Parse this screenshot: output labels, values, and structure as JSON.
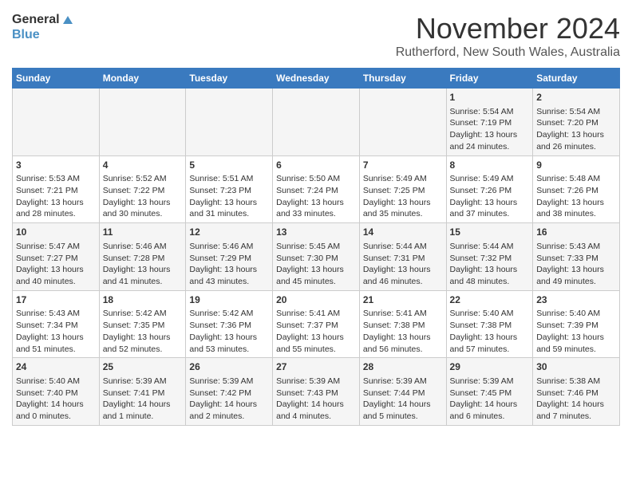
{
  "logo": {
    "line1": "General",
    "line2": "Blue"
  },
  "title": "November 2024",
  "location": "Rutherford, New South Wales, Australia",
  "weekdays": [
    "Sunday",
    "Monday",
    "Tuesday",
    "Wednesday",
    "Thursday",
    "Friday",
    "Saturday"
  ],
  "weeks": [
    [
      {
        "day": "",
        "content": ""
      },
      {
        "day": "",
        "content": ""
      },
      {
        "day": "",
        "content": ""
      },
      {
        "day": "",
        "content": ""
      },
      {
        "day": "",
        "content": ""
      },
      {
        "day": "1",
        "content": "Sunrise: 5:54 AM\nSunset: 7:19 PM\nDaylight: 13 hours\nand 24 minutes."
      },
      {
        "day": "2",
        "content": "Sunrise: 5:54 AM\nSunset: 7:20 PM\nDaylight: 13 hours\nand 26 minutes."
      }
    ],
    [
      {
        "day": "3",
        "content": "Sunrise: 5:53 AM\nSunset: 7:21 PM\nDaylight: 13 hours\nand 28 minutes."
      },
      {
        "day": "4",
        "content": "Sunrise: 5:52 AM\nSunset: 7:22 PM\nDaylight: 13 hours\nand 30 minutes."
      },
      {
        "day": "5",
        "content": "Sunrise: 5:51 AM\nSunset: 7:23 PM\nDaylight: 13 hours\nand 31 minutes."
      },
      {
        "day": "6",
        "content": "Sunrise: 5:50 AM\nSunset: 7:24 PM\nDaylight: 13 hours\nand 33 minutes."
      },
      {
        "day": "7",
        "content": "Sunrise: 5:49 AM\nSunset: 7:25 PM\nDaylight: 13 hours\nand 35 minutes."
      },
      {
        "day": "8",
        "content": "Sunrise: 5:49 AM\nSunset: 7:26 PM\nDaylight: 13 hours\nand 37 minutes."
      },
      {
        "day": "9",
        "content": "Sunrise: 5:48 AM\nSunset: 7:26 PM\nDaylight: 13 hours\nand 38 minutes."
      }
    ],
    [
      {
        "day": "10",
        "content": "Sunrise: 5:47 AM\nSunset: 7:27 PM\nDaylight: 13 hours\nand 40 minutes."
      },
      {
        "day": "11",
        "content": "Sunrise: 5:46 AM\nSunset: 7:28 PM\nDaylight: 13 hours\nand 41 minutes."
      },
      {
        "day": "12",
        "content": "Sunrise: 5:46 AM\nSunset: 7:29 PM\nDaylight: 13 hours\nand 43 minutes."
      },
      {
        "day": "13",
        "content": "Sunrise: 5:45 AM\nSunset: 7:30 PM\nDaylight: 13 hours\nand 45 minutes."
      },
      {
        "day": "14",
        "content": "Sunrise: 5:44 AM\nSunset: 7:31 PM\nDaylight: 13 hours\nand 46 minutes."
      },
      {
        "day": "15",
        "content": "Sunrise: 5:44 AM\nSunset: 7:32 PM\nDaylight: 13 hours\nand 48 minutes."
      },
      {
        "day": "16",
        "content": "Sunrise: 5:43 AM\nSunset: 7:33 PM\nDaylight: 13 hours\nand 49 minutes."
      }
    ],
    [
      {
        "day": "17",
        "content": "Sunrise: 5:43 AM\nSunset: 7:34 PM\nDaylight: 13 hours\nand 51 minutes."
      },
      {
        "day": "18",
        "content": "Sunrise: 5:42 AM\nSunset: 7:35 PM\nDaylight: 13 hours\nand 52 minutes."
      },
      {
        "day": "19",
        "content": "Sunrise: 5:42 AM\nSunset: 7:36 PM\nDaylight: 13 hours\nand 53 minutes."
      },
      {
        "day": "20",
        "content": "Sunrise: 5:41 AM\nSunset: 7:37 PM\nDaylight: 13 hours\nand 55 minutes."
      },
      {
        "day": "21",
        "content": "Sunrise: 5:41 AM\nSunset: 7:38 PM\nDaylight: 13 hours\nand 56 minutes."
      },
      {
        "day": "22",
        "content": "Sunrise: 5:40 AM\nSunset: 7:38 PM\nDaylight: 13 hours\nand 57 minutes."
      },
      {
        "day": "23",
        "content": "Sunrise: 5:40 AM\nSunset: 7:39 PM\nDaylight: 13 hours\nand 59 minutes."
      }
    ],
    [
      {
        "day": "24",
        "content": "Sunrise: 5:40 AM\nSunset: 7:40 PM\nDaylight: 14 hours\nand 0 minutes."
      },
      {
        "day": "25",
        "content": "Sunrise: 5:39 AM\nSunset: 7:41 PM\nDaylight: 14 hours\nand 1 minute."
      },
      {
        "day": "26",
        "content": "Sunrise: 5:39 AM\nSunset: 7:42 PM\nDaylight: 14 hours\nand 2 minutes."
      },
      {
        "day": "27",
        "content": "Sunrise: 5:39 AM\nSunset: 7:43 PM\nDaylight: 14 hours\nand 4 minutes."
      },
      {
        "day": "28",
        "content": "Sunrise: 5:39 AM\nSunset: 7:44 PM\nDaylight: 14 hours\nand 5 minutes."
      },
      {
        "day": "29",
        "content": "Sunrise: 5:39 AM\nSunset: 7:45 PM\nDaylight: 14 hours\nand 6 minutes."
      },
      {
        "day": "30",
        "content": "Sunrise: 5:38 AM\nSunset: 7:46 PM\nDaylight: 14 hours\nand 7 minutes."
      }
    ]
  ]
}
